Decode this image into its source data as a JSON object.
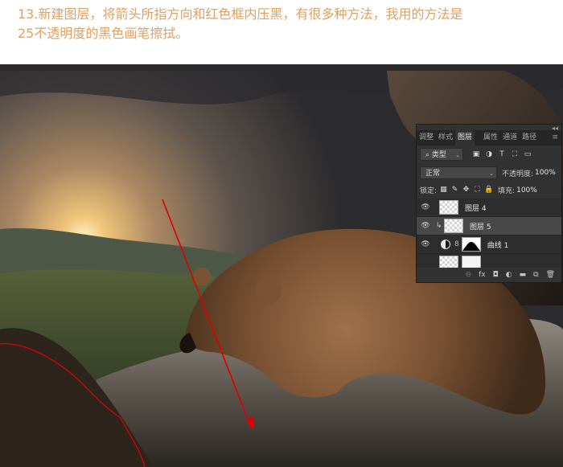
{
  "instruction": {
    "line1": "13.新建图层，将箭头所指方向和红色框内压黑，有很多种方法，我用的方法是",
    "line2": "25不透明度的黑色画笔擦拭。"
  },
  "colors": {
    "instruction_text": "#e0a060",
    "panel_bg": "#323232",
    "annotation_red": "#e00000"
  },
  "panel": {
    "collapse_label": "◂◂",
    "tabs": [
      "调整",
      "样式",
      "图层",
      "属性",
      "通道",
      "路径"
    ],
    "active_tab": "图层",
    "tabs_menu": "≡",
    "filter": {
      "search_glyph": "⌕",
      "label": "类型",
      "caret": "⌄"
    },
    "filter_icons": [
      "▣",
      "◑",
      "T",
      "⛶",
      "▭"
    ],
    "blend_mode": "正常",
    "blend_caret": "⌄",
    "opacity_label": "不透明度:",
    "opacity_value": "100%",
    "lock_label": "锁定:",
    "lock_icons": [
      "▦",
      "✎",
      "✥",
      "⛶",
      "🔒"
    ],
    "fill_label": "填充:",
    "fill_value": "100%",
    "layers": [
      {
        "name": "图层 4",
        "visible": true,
        "eye": "👁"
      },
      {
        "name": "图层 5",
        "visible": true,
        "eye": "👁",
        "clip": "↳",
        "selected": true
      },
      {
        "name": "曲线 1",
        "visible": true,
        "eye": "👁",
        "chain": "8"
      },
      {
        "name": "",
        "visible": false,
        "eye": ""
      }
    ],
    "footer_icons": [
      "⊖",
      "fx",
      "◘",
      "◐",
      "▬",
      "⧉",
      "🗑"
    ]
  }
}
